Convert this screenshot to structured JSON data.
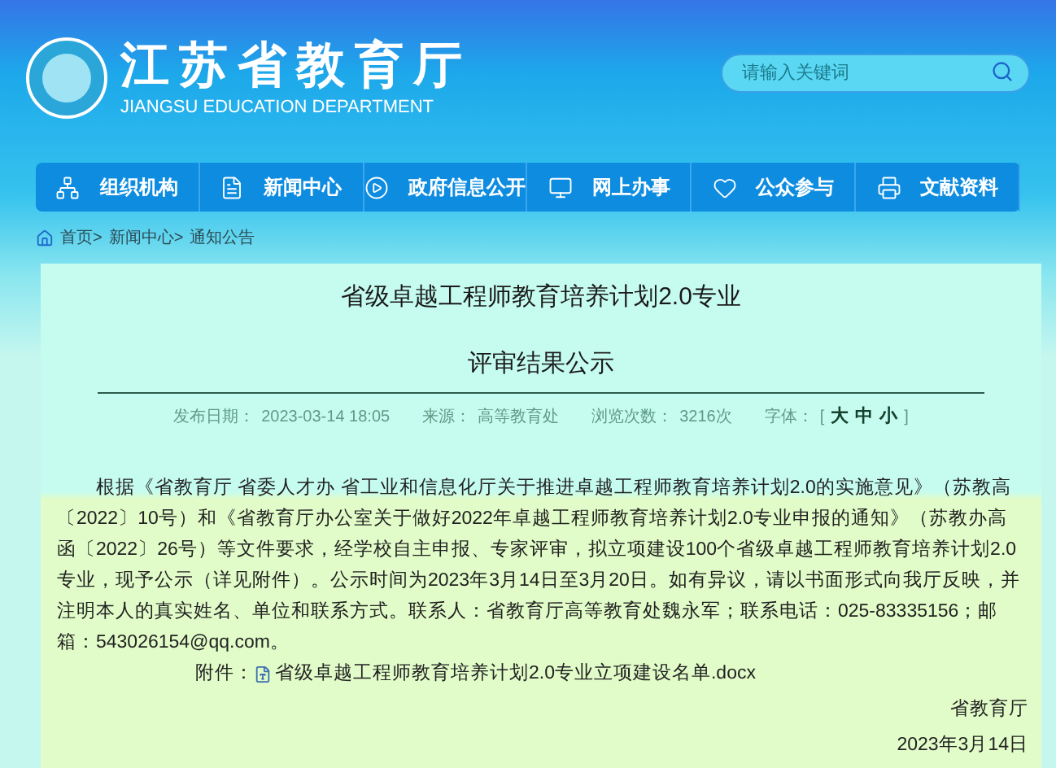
{
  "header": {
    "title": "江苏省教育厅",
    "subtitle": "JIANGSU EDUCATION DEPARTMENT",
    "search": {
      "placeholder": "请输入关键词"
    }
  },
  "nav": [
    {
      "label": "组织机构"
    },
    {
      "label": "新闻中心"
    },
    {
      "label": "政府信息公开"
    },
    {
      "label": "网上办事"
    },
    {
      "label": "公众参与"
    },
    {
      "label": "文献资料"
    }
  ],
  "breadcrumb": [
    "首页>",
    "新闻中心>",
    "通知公告"
  ],
  "article": {
    "title": "省级卓越工程师教育培养计划2.0专业",
    "subtitle": "评审结果公示",
    "meta": [
      {
        "label": "发布日期：",
        "value": "2023-03-14 18:05"
      },
      {
        "label": "来源：",
        "value": "高等教育处"
      },
      {
        "label": "浏览次数：",
        "value": "3216次"
      }
    ],
    "font_size": {
      "label": "字体：",
      "open": "[",
      "options": [
        "大",
        "中",
        "小"
      ],
      "close": "]"
    },
    "body": "根据《省教育厅 省委人才办 省工业和信息化厅关于推进卓越工程师教育培养计划2.0的实施意见》（苏教高〔2022〕10号）和《省教育厅办公室关于做好2022年卓越工程师教育培养计划2.0专业申报的通知》（苏教办高函〔2022〕26号）等文件要求，经学校自主申报、专家评审，拟立项建设100个省级卓越工程师教育培养计划2.0专业，现予公示（详见附件）。公示时间为2023年3月14日至3月20日。如有异议，请以书面形式向我厅反映，并注明本人的真实姓名、单位和联系方式。联系人：省教育厅高等教育处魏永军；联系电话：025-83335156；邮箱：543026154@qq.com。",
    "attachment": {
      "label": "附件：",
      "file": "省级卓越工程师教育培养计划2.0专业立项建设名单.docx"
    },
    "signature": [
      "省教育厅",
      "2023年3月14日"
    ]
  }
}
